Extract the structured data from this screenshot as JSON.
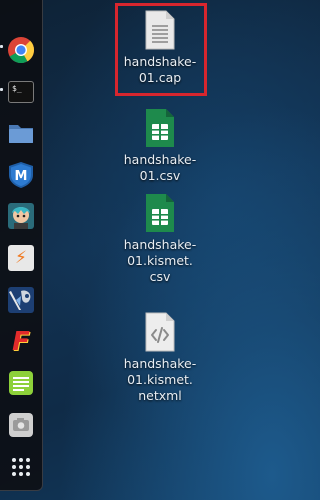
{
  "dock": {
    "items": [
      {
        "name": "chrome-icon"
      },
      {
        "name": "terminal-icon",
        "text": "$_"
      },
      {
        "name": "folder-icon"
      },
      {
        "name": "metasploit-icon",
        "text": "M"
      },
      {
        "name": "armitage-icon"
      },
      {
        "name": "burpsuite-icon",
        "text": "⚡"
      },
      {
        "name": "beef-icon"
      },
      {
        "name": "faraday-icon",
        "text": "F"
      },
      {
        "name": "text-editor-icon"
      },
      {
        "name": "screenshot-icon"
      },
      {
        "name": "show-applications-icon"
      }
    ]
  },
  "desktop": {
    "files": [
      {
        "label": "handshake-\n01.cap",
        "type": "text"
      },
      {
        "label": "handshake-\n01.csv",
        "type": "spreadsheet"
      },
      {
        "label": "handshake-\n01.kismet.\ncsv",
        "type": "spreadsheet"
      },
      {
        "label": "handshake-\n01.kismet.\nnetxml",
        "type": "xml"
      }
    ],
    "selected_index": 0
  },
  "colors": {
    "selection": "#d7262e",
    "spreadsheet": "#1e8a4c"
  }
}
